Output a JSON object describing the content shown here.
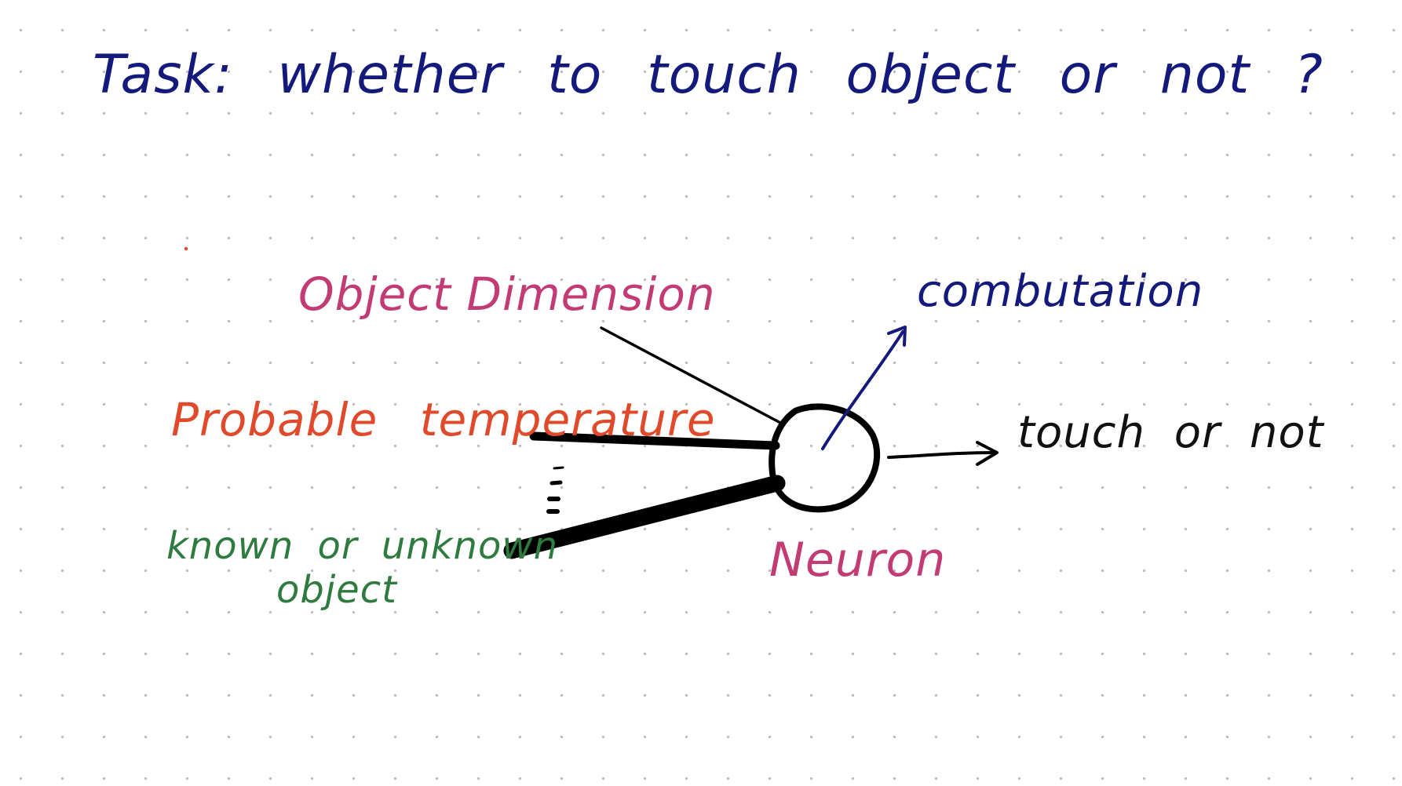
{
  "title": "Task: whether to touch object or not ?",
  "inputs": {
    "dimension": "Object Dimension",
    "temperature": "Probable temperature",
    "known_line1": "known or unknown",
    "known_line2": "object"
  },
  "node": {
    "label": "Neuron"
  },
  "computation_label": "combutation",
  "output_label": "touch or not",
  "colors": {
    "title": "#141a7c",
    "dimension": "#c23b74",
    "temperature": "#e0492a",
    "known": "#2e7a3f",
    "neuron_label": "#c23b74",
    "ink": "#000000"
  }
}
